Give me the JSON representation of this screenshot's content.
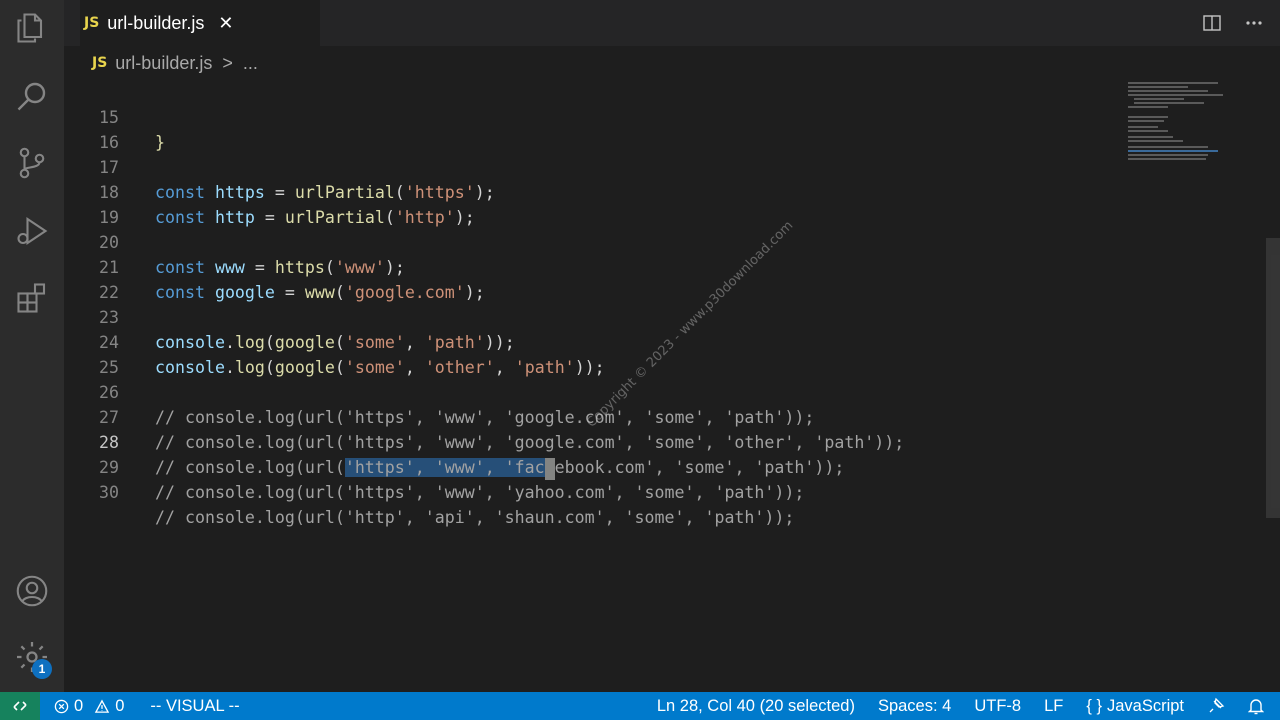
{
  "tab": {
    "badge": "JS",
    "title": "url-builder.js",
    "close": "✕"
  },
  "breadcrumb": {
    "badge": "JS",
    "file": "url-builder.js",
    "sep": ">",
    "more": "..."
  },
  "editor": {
    "lines": [
      {
        "n": "15"
      },
      {
        "n": "16"
      },
      {
        "n": "17"
      },
      {
        "n": "18"
      },
      {
        "n": "19"
      },
      {
        "n": "20"
      },
      {
        "n": "21"
      },
      {
        "n": "22"
      },
      {
        "n": "23"
      },
      {
        "n": "24"
      },
      {
        "n": "25"
      },
      {
        "n": "26"
      },
      {
        "n": "27"
      },
      {
        "n": "28"
      },
      {
        "n": "29"
      },
      {
        "n": "30"
      }
    ],
    "tokens": {
      "brace": "}",
      "const": "const",
      "https": "https",
      "http": "http",
      "www": "www",
      "google": "google",
      "urlPartial": "urlPartial",
      "console": "console",
      "log": "log",
      "eq": " = ",
      "s_https": "'https'",
      "s_http": "'http'",
      "s_www": "'www'",
      "s_google": "'google.com'",
      "s_some": "'some'",
      "s_path": "'path'",
      "s_other": "'other'"
    },
    "comments": {
      "c26": "// console.log(url('https', 'www', 'google.com', 'some', 'path'));",
      "c27": "// console.log(url('https', 'www', 'google.com', 'some', 'other', 'path'));",
      "c28_pre": "// console.log(url(",
      "c28_sel": "'https', 'www', 'fac",
      "c28_post": "ebook.com', 'some', 'path'));",
      "c29": "// console.log(url('https', 'www', 'yahoo.com', 'some', 'path'));",
      "c30": "// console.log(url('http', 'api', 'shaun.com', 'some', 'path'));"
    }
  },
  "watermark": "Copyright © 2023 - www.p30download.com",
  "status": {
    "errors": "0",
    "warnings": "0",
    "mode": "-- VISUAL --",
    "position": "Ln 28, Col 40 (20 selected)",
    "spaces": "Spaces: 4",
    "encoding": "UTF-8",
    "eol": "LF",
    "language": "JavaScript",
    "language_icon": "{ }"
  },
  "activity": {
    "badge_count": "1"
  },
  "colors": {
    "accent": "#007acc",
    "remote": "#16825d",
    "selection": "#264f78"
  }
}
